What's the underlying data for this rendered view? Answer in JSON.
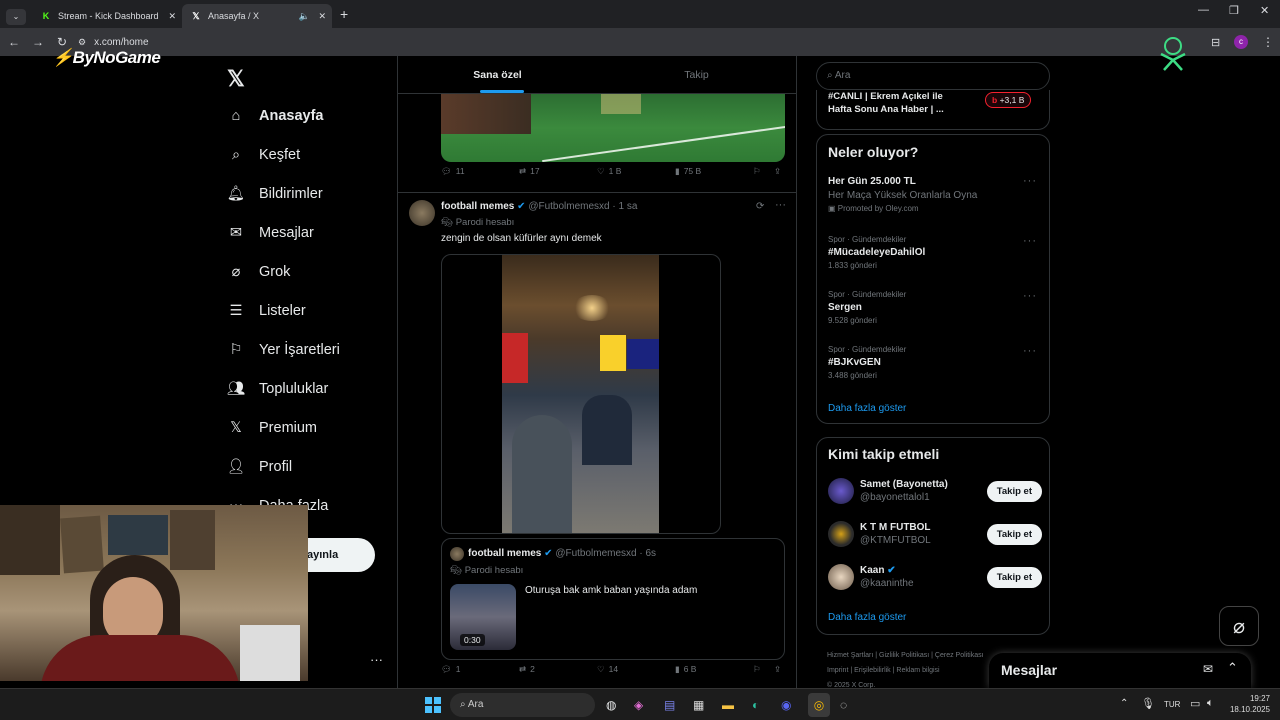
{
  "browser": {
    "tabs": [
      {
        "title": "Stream - Kick Dashboard",
        "favicon": "K",
        "color": "#53fc18"
      },
      {
        "title": "Anasayfa / X",
        "favicon": "X",
        "color": "#ffffff"
      }
    ],
    "url": "x.com/home"
  },
  "overlay_logo": "ByNoGame",
  "nav": {
    "items": [
      {
        "label": "Anasayfa",
        "icon": "home-icon"
      },
      {
        "label": "Keşfet",
        "icon": "search-icon"
      },
      {
        "label": "Bildirimler",
        "icon": "bell-icon"
      },
      {
        "label": "Mesajlar",
        "icon": "mail-icon"
      },
      {
        "label": "Grok",
        "icon": "grok-icon"
      },
      {
        "label": "Listeler",
        "icon": "list-icon"
      },
      {
        "label": "Yer İşaretleri",
        "icon": "bookmark-icon"
      },
      {
        "label": "Topluluklar",
        "icon": "communities-icon"
      },
      {
        "label": "Premium",
        "icon": "x-logo-icon"
      },
      {
        "label": "Profil",
        "icon": "profile-icon"
      },
      {
        "label": "Daha fazla",
        "icon": "more-circle-icon"
      }
    ],
    "post_button": "ayınla"
  },
  "feed": {
    "tabs": [
      "Sana özel",
      "Takip"
    ],
    "first_post_actions": {
      "replies": "11",
      "reposts": "17",
      "likes": "1 B",
      "views": "75 B"
    },
    "post": {
      "name": "football memes",
      "handle": "@Futbolmemesxd",
      "time": "1 sa",
      "badge": "Parodi hesabı",
      "text": "zengin de olsan küfürler aynı demek",
      "quote": {
        "name": "football memes",
        "handle": "@Futbolmemesxd",
        "time": "6s",
        "badge": "Parodi hesabı",
        "text": "Oturuşa bak amk baban yaşında adam",
        "duration": "0:30"
      },
      "actions": {
        "replies": "1",
        "reposts": "2",
        "likes": "14",
        "views": "6 B"
      }
    }
  },
  "right": {
    "search_placeholder": "Ara",
    "live": {
      "line1": "#CANLI | Ekrem Açıkel ile",
      "line2": "Hafta Sonu Ana Haber | ...",
      "count": "+3,1 B"
    },
    "trends_title": "Neler oluyor?",
    "trends": [
      {
        "title": "Her Gün 25.000 TL",
        "sub": "Her Maça Yüksek Oranlarla Oyna",
        "meta": "Promoted by Oley.com"
      },
      {
        "category": "Spor · Gündemdekiler",
        "title": "#MücadeleyeDahilOl",
        "count": "1.833 gönderi"
      },
      {
        "category": "Spor · Gündemdekiler",
        "title": "Sergen",
        "count": "9.528 gönderi"
      },
      {
        "category": "Spor · Gündemdekiler",
        "title": "#BJKvGEN",
        "count": "3.488 gönderi"
      }
    ],
    "show_more": "Daha fazla göster",
    "who_title": "Kimi takip etmeli",
    "who": [
      {
        "name": "Samet (Bayonetta)",
        "handle": "@bayonettalol1",
        "button": "Takip et"
      },
      {
        "name": "K T M FUTBOL",
        "handle": "@KTMFUTBOL",
        "button": "Takip et"
      },
      {
        "name": "Kaan",
        "handle": "@kaaninthe",
        "button": "Takip et"
      }
    ],
    "who_more": "Daha fazla göster",
    "footer": [
      "Hizmet Şartları",
      "Gizlilik Politikası",
      "Çerez Politikası",
      "Imprint",
      "Erişilebilirlik",
      "Reklam bilgisi"
    ],
    "copyright": "© 2025 X Corp."
  },
  "messages_drawer": "Mesajlar",
  "taskbar": {
    "search": "Ara",
    "lang": "TUR",
    "time": "19:27",
    "date": "18.10.2025"
  }
}
